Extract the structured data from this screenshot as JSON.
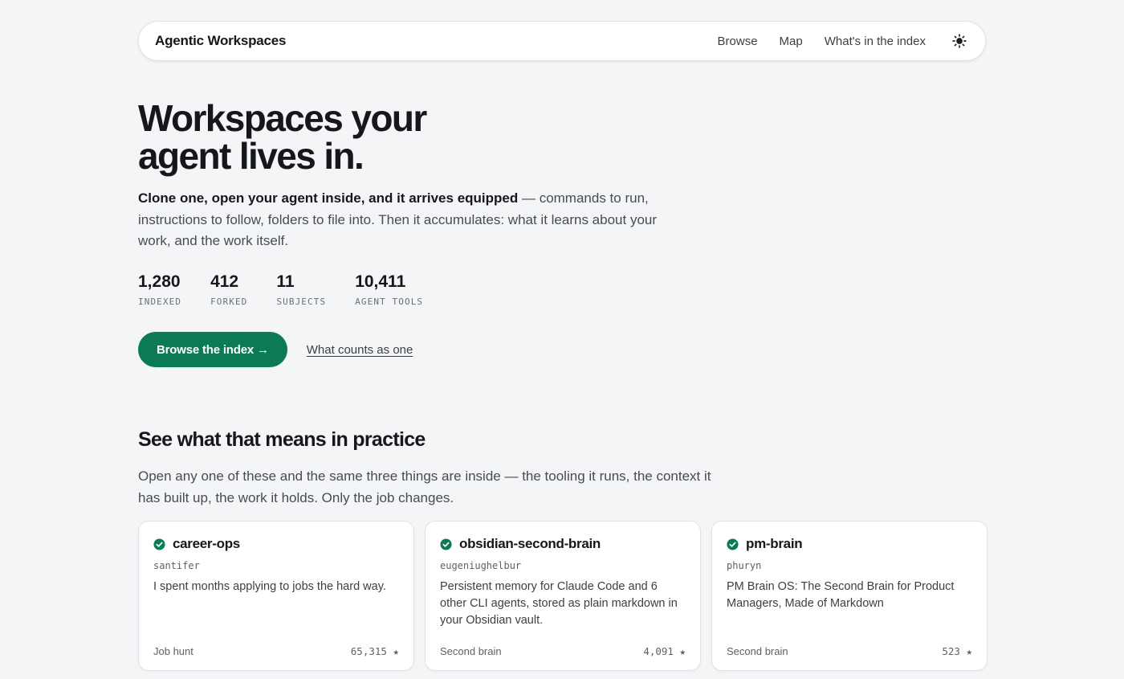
{
  "nav": {
    "brand": "Agentic Workspaces",
    "links": [
      "Browse",
      "Map",
      "What's in the index"
    ],
    "theme_icon": "sun-icon"
  },
  "hero": {
    "title_line1": "Workspaces your",
    "title_line2": "agent lives in.",
    "desc_bold": "Clone one, open your agent inside, and it arrives equipped",
    "desc_rest": " — commands to run, instructions to follow, folders to file into. Then it accumulates: what it learns about your work, and the work itself.",
    "stats": [
      {
        "value": "1,280",
        "label": "INDEXED"
      },
      {
        "value": "412",
        "label": "FORKED"
      },
      {
        "value": "11",
        "label": "SUBJECTS"
      },
      {
        "value": "10,411",
        "label": "AGENT TOOLS"
      }
    ],
    "cta_label": "Browse the index →",
    "secondary_link": "What counts as one"
  },
  "section": {
    "title": "See what that means in practice",
    "desc": "Open any one of these and the same three things are inside — the tooling it runs, the context it has built up, the work it holds. Only the job changes."
  },
  "cards": [
    {
      "title": "career-ops",
      "author": "santifer",
      "desc": "I spent months applying to jobs the hard way.",
      "tag": "Job hunt",
      "stars": "65,315 ★"
    },
    {
      "title": "obsidian-second-brain",
      "author": "eugeniughelbur",
      "desc": "Persistent memory for Claude Code and 6 other CLI agents, stored as plain markdown in your Obsidian vault.",
      "tag": "Second brain",
      "stars": "4,091 ★"
    },
    {
      "title": "pm-brain",
      "author": "phuryn",
      "desc": "PM Brain OS: The Second Brain for Product Managers, Made of Markdown",
      "tag": "Second brain",
      "stars": "523 ★"
    }
  ],
  "colors": {
    "accent": "#0b7a55",
    "background": "#f4f5f7",
    "card": "#ffffff"
  }
}
